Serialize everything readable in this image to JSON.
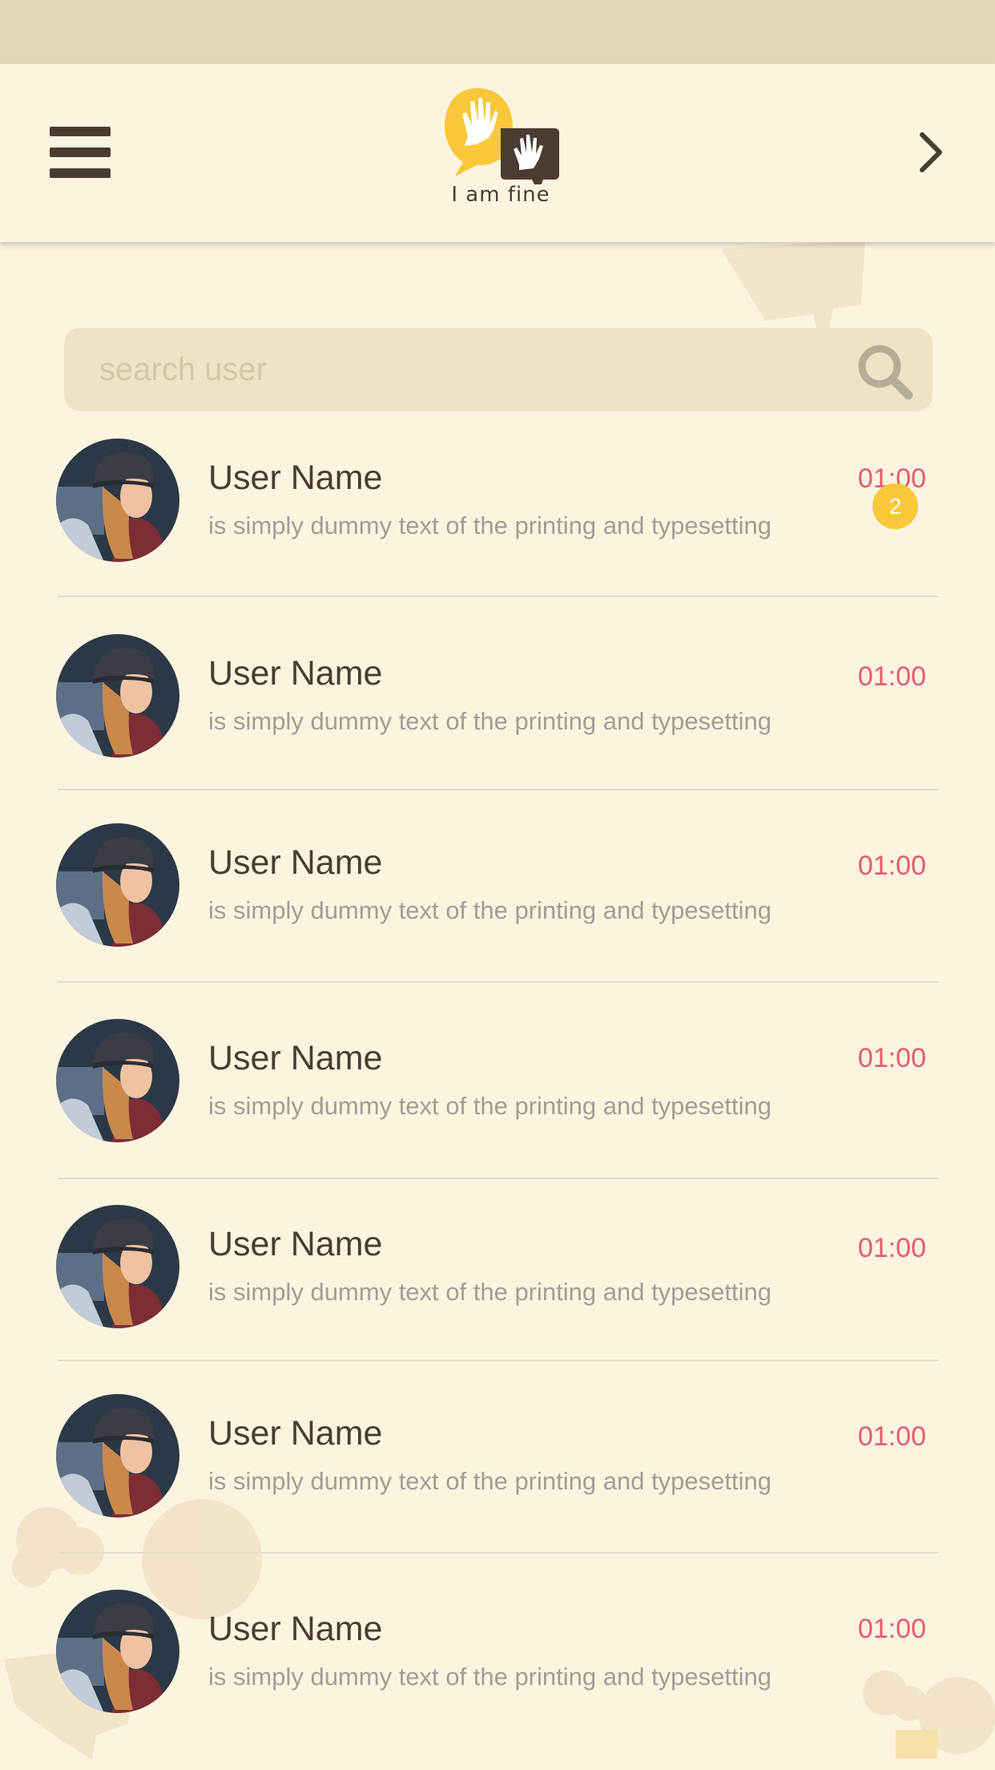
{
  "header": {
    "logo_text": "I am fine"
  },
  "search": {
    "placeholder": "search user"
  },
  "colors": {
    "background": "#fdf4e0",
    "status_bar": "#e3d8b6",
    "search_bg": "#ede3c5",
    "time": "#e25d6b",
    "badge": "#f8c83a",
    "text_dark": "#4a3c33",
    "text_muted": "#a39c96"
  },
  "icons": {
    "menu": "hamburger-icon",
    "next": "chevron-right-icon",
    "search": "search-icon"
  },
  "chats": [
    {
      "name": "User Name",
      "message": "is simply dummy text of the printing and typesetting",
      "time": "01:00",
      "unread": "2"
    },
    {
      "name": "User Name",
      "message": "is simply dummy text of the printing and typesetting",
      "time": "01:00"
    },
    {
      "name": "User Name",
      "message": "is simply dummy text of the printing and typesetting",
      "time": "01:00"
    },
    {
      "name": "User Name",
      "message": "is simply dummy text of the printing and typesetting",
      "time": "01:00"
    },
    {
      "name": "User Name",
      "message": "is simply dummy text of the printing and typesetting",
      "time": "01:00"
    },
    {
      "name": "User Name",
      "message": "is simply dummy text of the printing and typesetting",
      "time": "01:00"
    },
    {
      "name": "User Name",
      "message": "is simply dummy text of the printing and typesetting",
      "time": "01:00"
    }
  ]
}
